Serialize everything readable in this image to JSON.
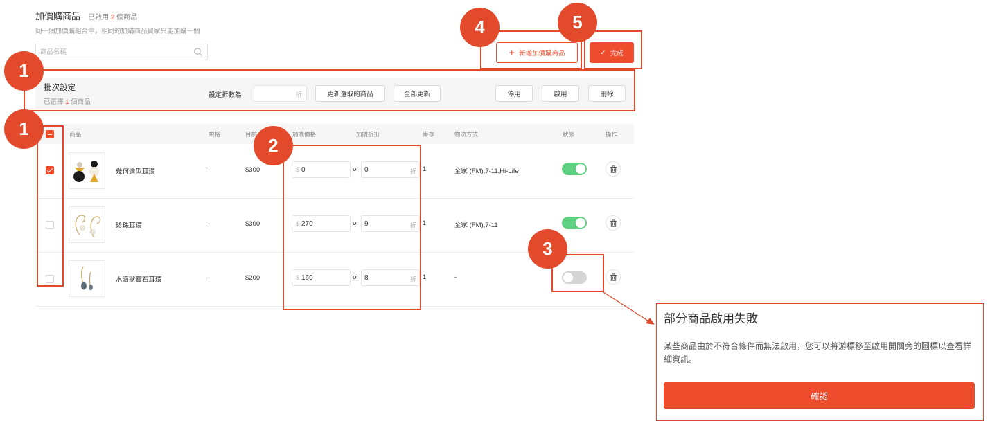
{
  "header": {
    "title": "加價購商品",
    "enabled_prefix": "已啟用",
    "enabled_count": "2",
    "enabled_suffix": "個商品",
    "subtitle": "同一個加價購組合中，相同的加購商品買家只能加購一個"
  },
  "search": {
    "placeholder": "商品名稱",
    "icon": "search-icon"
  },
  "toolbar": {
    "add_label": "新增加價購商品",
    "done_label": "完成"
  },
  "batch": {
    "title": "批次設定",
    "selected_prefix": "已選擇",
    "selected_count": "1",
    "selected_suffix": "個商品",
    "discount_label": "設定折數為",
    "discount_suffix": "折",
    "update_selected": "更新選取的商品",
    "update_all": "全部更新",
    "disable": "停用",
    "enable": "啟用",
    "delete": "刪除"
  },
  "table": {
    "headers": {
      "product": "商品",
      "spec": "規格",
      "target_price": "目前",
      "addon_price": "加購價格",
      "addon_discount": "加購折扣",
      "stock": "庫存",
      "shipping": "物流方式",
      "status": "狀態",
      "action": "操作"
    },
    "rows": [
      {
        "checked": true,
        "name": "幾何造型耳環",
        "spec": "-",
        "price": "$300",
        "currency": "$",
        "addon_price": "0",
        "or": "or",
        "discount": "0",
        "discount_suffix": "折",
        "stock": "1",
        "shipping": "全家 (FM),7-11,Hi-Life",
        "enabled": true
      },
      {
        "checked": false,
        "name": "珍珠耳環",
        "spec": "-",
        "price": "$300",
        "currency": "$",
        "addon_price": "270",
        "or": "or",
        "discount": "9",
        "discount_suffix": "折",
        "stock": "1",
        "shipping": "全家 (FM),7-11",
        "enabled": true
      },
      {
        "checked": false,
        "name": "水滴狀寶石耳環",
        "spec": "-",
        "price": "$200",
        "currency": "$",
        "addon_price": "160",
        "or": "or",
        "discount": "8",
        "discount_suffix": "折",
        "stock": "1",
        "shipping": "-",
        "enabled": false
      }
    ]
  },
  "annotations": {
    "b1": "1",
    "b2": "2",
    "b3": "3",
    "b4": "4",
    "b5": "5"
  },
  "dialog": {
    "title": "部分商品啟用失敗",
    "body": "某些商品由於不符合條件而無法啟用，您可以將游標移至啟用開關旁的圖標以查看詳細資訊。",
    "confirm": "確認"
  },
  "colors": {
    "accent": "#ee4d2d",
    "annotation": "#e34a2b",
    "toggle_on": "#5fcf80",
    "toggle_off": "#d5d5d5"
  }
}
